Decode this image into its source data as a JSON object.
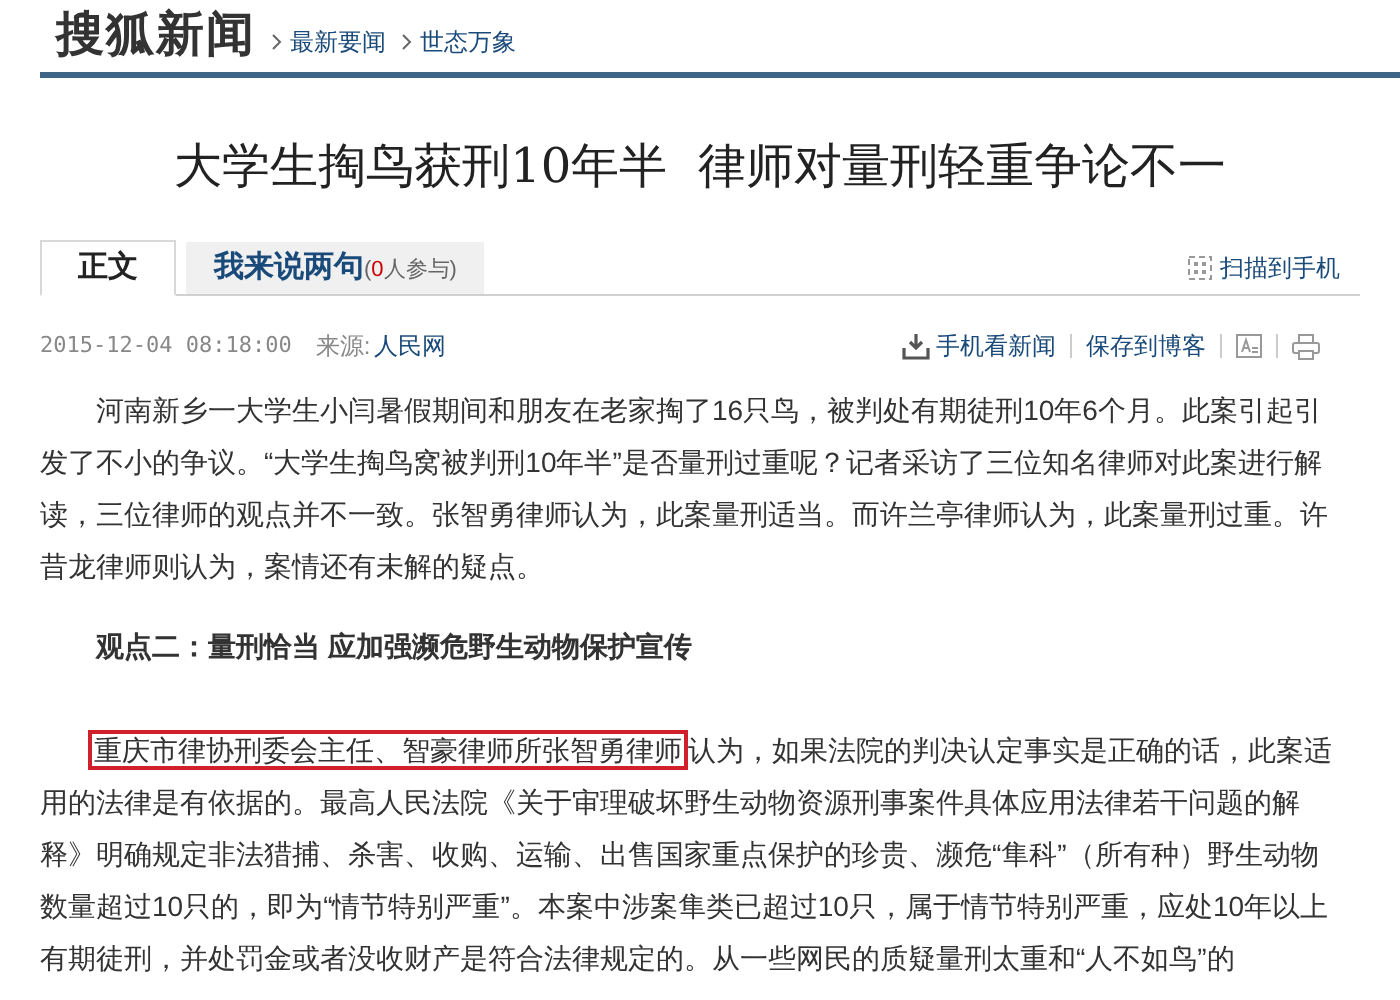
{
  "header": {
    "logo": "搜狐新闻",
    "breadcrumbs": [
      "最新要闻",
      "世态万象"
    ]
  },
  "title": "大学生掏鸟获刑10年半  律师对量刑轻重争论不一",
  "tabs": [
    {
      "label": "正文",
      "selected": true
    },
    {
      "label": "我来说两句",
      "count_prefix": "(",
      "count": "0",
      "count_suffix": "人参与)",
      "selected": false
    }
  ],
  "scan_link": "扫描到手机",
  "meta": {
    "datetime": "2015-12-04 08:18:00",
    "source_label": "来源:",
    "source": "人民网"
  },
  "actions": [
    "手机看新闻",
    "保存到博客"
  ],
  "body": [
    {
      "kind": "paragraph",
      "text": "河南新乡一大学生小闫暑假期间和朋友在老家掏了16只鸟，被判处有期徒刑10年6个月。此案引起引发了不小的争议。“大学生掏鸟窝被判刑10年半”是否量刑过重呢？记者采访了三位知名律师对此案进行解读，三位律师的观点并不一致。张智勇律师认为，此案量刑适当。而许兰亭律师认为，此案量刑过重。许昔龙律师则认为，案情还有未解的疑点。"
    },
    {
      "kind": "heading",
      "text": "观点二：量刑恰当 应加强濒危野生动物保护宣传"
    },
    {
      "kind": "highlighted",
      "highlight": "重庆市律协刑委会主任、智豪律师所张智勇律师",
      "text": "认为，如果法院的判决认定事实是正确的话，此案适用的法律是有依据的。最高人民法院《关于审理破坏野生动物资源刑事案件具体应用法律若干问题的解释》明确规定非法猎捕、杀害、收购、运输、出售国家重点保护的珍贵、濒危“隼科”（所有种）野生动物数量超过10只的，即为“情节特别严重”。本案中涉案隼类已超过10只，属于情节特别严重，应处10年以上有期徒刑，并处罚金或者没收财产是符合法律规定的。从一些网民的质疑量刑太重和“人不如鸟”的"
    }
  ]
}
